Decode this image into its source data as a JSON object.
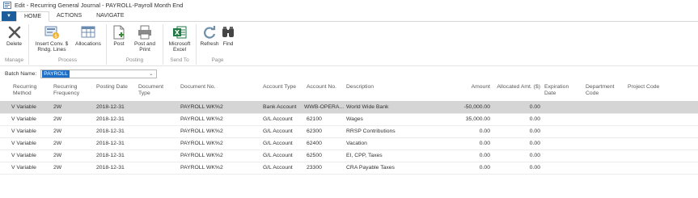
{
  "window": {
    "title": "Edit - Recurring General Journal - PAYROLL-Payroll Month End"
  },
  "ribbon": {
    "tabs": [
      {
        "label": "HOME",
        "active": true
      },
      {
        "label": "ACTIONS",
        "active": false
      },
      {
        "label": "NAVIGATE",
        "active": false
      }
    ],
    "groups": [
      {
        "label": "Manage",
        "buttons": [
          {
            "label": "Delete",
            "icon": "delete-x-icon"
          }
        ]
      },
      {
        "label": "Process",
        "buttons": [
          {
            "label": "Insert Conv. $ Rndg. Lines",
            "icon": "insert-conv-icon"
          },
          {
            "label": "Allocations",
            "icon": "allocations-icon"
          }
        ]
      },
      {
        "label": "Posting",
        "buttons": [
          {
            "label": "Post",
            "icon": "post-icon"
          },
          {
            "label": "Post and Print",
            "icon": "post-print-icon"
          }
        ]
      },
      {
        "label": "Send To",
        "buttons": [
          {
            "label": "Microsoft Excel",
            "icon": "excel-icon"
          }
        ]
      },
      {
        "label": "Page",
        "buttons": [
          {
            "label": "Refresh",
            "icon": "refresh-icon"
          },
          {
            "label": "Find",
            "icon": "binoculars-icon"
          }
        ]
      }
    ]
  },
  "batch": {
    "label": "Batch Name:",
    "value": "PAYROLL"
  },
  "grid": {
    "columns": [
      "Recurring Method",
      "Recurring Frequency",
      "Posting Date",
      "Document Type",
      "Document No.",
      "Account Type",
      "Account No.",
      "Description",
      "Amount",
      "Allocated Amt. ($)",
      "Expiration Date",
      "Department Code",
      "Project Code"
    ],
    "rows": [
      {
        "method": "V Variable",
        "frequency": "2W",
        "date": "2018-12-31",
        "doc_type": "",
        "doc_no": "PAYROLL WK%2",
        "acc_type": "Bank Account",
        "acc_no": "WWB-OPERA...",
        "description": "World Wide Bank",
        "amount": "-50,000.00",
        "allocated": "0.00",
        "selected": true
      },
      {
        "method": "V Variable",
        "frequency": "2W",
        "date": "2018-12-31",
        "doc_type": "",
        "doc_no": "PAYROLL WK%2",
        "acc_type": "G/L Account",
        "acc_no": "62100",
        "description": "Wages",
        "amount": "35,000.00",
        "allocated": "0.00",
        "selected": false
      },
      {
        "method": "V Variable",
        "frequency": "2W",
        "date": "2018-12-31",
        "doc_type": "",
        "doc_no": "PAYROLL WK%2",
        "acc_type": "G/L Account",
        "acc_no": "62300",
        "description": "RRSP Contributions",
        "amount": "0.00",
        "allocated": "0.00",
        "selected": false
      },
      {
        "method": "V Variable",
        "frequency": "2W",
        "date": "2018-12-31",
        "doc_type": "",
        "doc_no": "PAYROLL WK%2",
        "acc_type": "G/L Account",
        "acc_no": "62400",
        "description": "Vacation",
        "amount": "0.00",
        "allocated": "0.00",
        "selected": false
      },
      {
        "method": "V Variable",
        "frequency": "2W",
        "date": "2018-12-31",
        "doc_type": "",
        "doc_no": "PAYROLL WK%2",
        "acc_type": "G/L Account",
        "acc_no": "62500",
        "description": "EI, CPP, Taxes",
        "amount": "0.00",
        "allocated": "0.00",
        "selected": false
      },
      {
        "method": "V Variable",
        "frequency": "2W",
        "date": "2018-12-31",
        "doc_type": "",
        "doc_no": "PAYROLL WK%2",
        "acc_type": "G/L Account",
        "acc_no": "23300",
        "description": "CRA Payable Taxes",
        "amount": "0.00",
        "allocated": "0.00",
        "selected": false
      }
    ]
  }
}
